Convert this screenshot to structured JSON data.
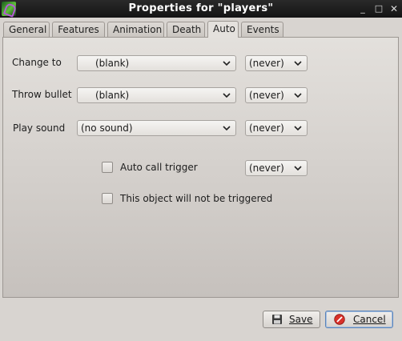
{
  "window": {
    "title": "Properties for \"players\""
  },
  "titlebar_buttons": {
    "minimize": "_",
    "maximize": "□",
    "close": "✕"
  },
  "tabs": [
    {
      "label": "General"
    },
    {
      "label": "Features"
    },
    {
      "label": "Animation"
    },
    {
      "label": "Death"
    },
    {
      "label": "Auto",
      "active": true
    },
    {
      "label": "Events"
    }
  ],
  "auto": {
    "change_to": {
      "label": "Change to",
      "value": "(blank)",
      "when": "(never)"
    },
    "throw_bullet": {
      "label": "Throw bullet",
      "value": "(blank)",
      "when": "(never)"
    },
    "play_sound": {
      "label": "Play sound",
      "value": "(no sound)",
      "when": "(never)"
    },
    "auto_call_trigger": {
      "label": "Auto call trigger",
      "checked": false,
      "when": "(never)"
    },
    "not_triggered": {
      "label": "This object will not be triggered",
      "checked": false
    }
  },
  "buttons": {
    "save": "Save",
    "cancel": "Cancel"
  },
  "colors": {
    "titlebar": "#1c1c1c",
    "focus_border": "#5b84b8",
    "cancel_icon": "#d8322b"
  }
}
